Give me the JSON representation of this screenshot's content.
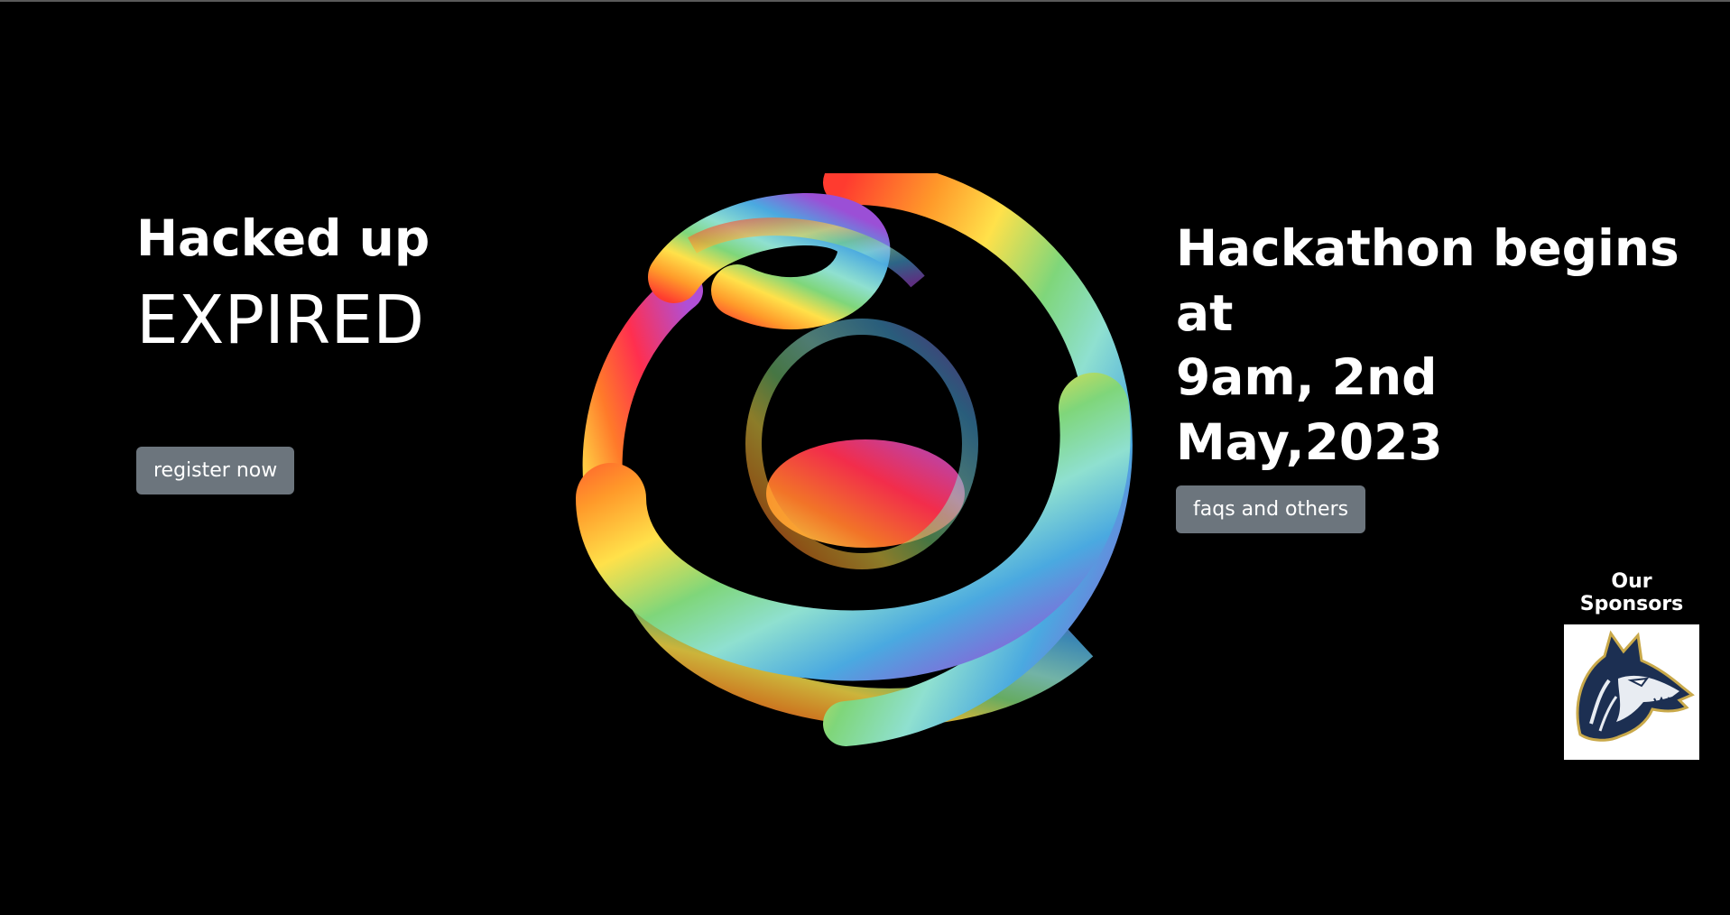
{
  "hero": {
    "title": "Hacked up",
    "countdown": "EXPIRED",
    "register_label": "register now"
  },
  "event": {
    "line1": "Hackathon begins at",
    "line2": "9am, 2nd May,2023",
    "faq_label": "faqs and others"
  },
  "sponsors": {
    "title": "Our Sponsors",
    "logo_icon": "husky-mascot-icon"
  },
  "colors": {
    "background": "#000000",
    "button": "#6c757d",
    "text": "#ffffff"
  },
  "orb_icon": "rainbow-spiral-sphere"
}
